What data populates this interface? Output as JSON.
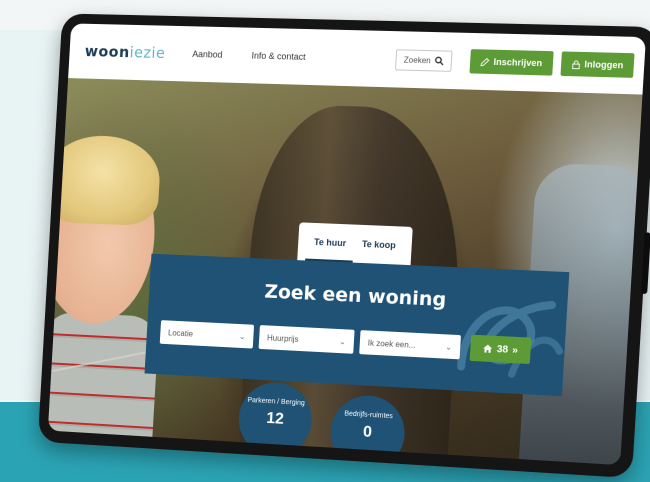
{
  "header": {
    "logo_main": "woon",
    "logo_light": "iezie",
    "nav": [
      "Aanbod",
      "Info & contact"
    ],
    "search_label": "Zoeken",
    "register_label": "Inschrijven",
    "login_label": "Inloggen"
  },
  "tabs": [
    "Te huur",
    "Te koop"
  ],
  "search": {
    "title": "Zoek een woning",
    "location_placeholder": "Locatie",
    "price_placeholder": "Huurprijs",
    "type_placeholder": "Ik zoek een...",
    "result_count": "38",
    "result_arrow": "»"
  },
  "bubbles": [
    {
      "label": "Parkeren / Berging",
      "value": "12"
    },
    {
      "label": "Bedrijfs-ruimtes",
      "value": "0"
    }
  ],
  "colors": {
    "brand_navy": "#1f5275",
    "brand_green": "#5c9b36",
    "accent_teal": "#2aa3b4"
  }
}
